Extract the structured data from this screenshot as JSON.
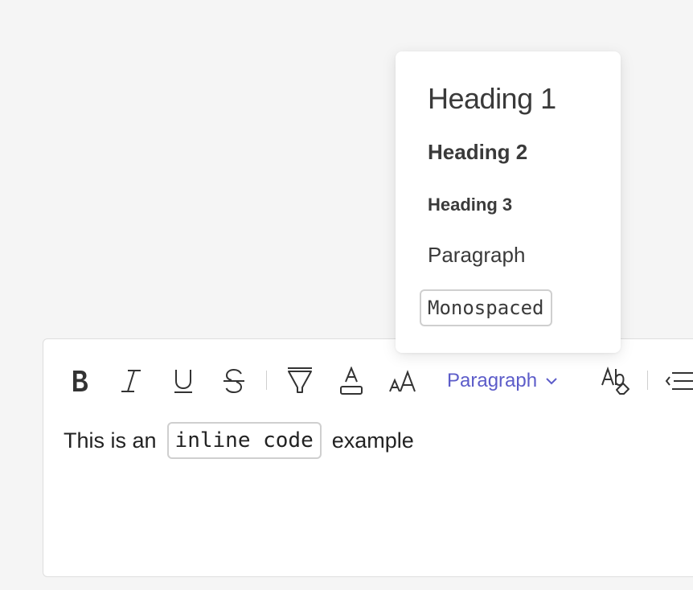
{
  "dropdown": {
    "items": [
      {
        "label": "Heading 1"
      },
      {
        "label": "Heading 2"
      },
      {
        "label": "Heading 3"
      },
      {
        "label": "Paragraph"
      },
      {
        "label": "Monospaced"
      }
    ]
  },
  "toolbar": {
    "buttons": [
      "bold-icon",
      "italic-icon",
      "underline-icon",
      "strikethrough-icon",
      "highlight-icon",
      "text-color-icon",
      "font-size-icon",
      "clear-format-icon",
      "indent-icon"
    ],
    "block_type": "Paragraph"
  },
  "content": {
    "before": "This is an",
    "code": "inline code",
    "after": "example"
  },
  "colors": {
    "accent": "#5c5cc9",
    "background": "#f5f5f5",
    "border": "#dedede"
  }
}
